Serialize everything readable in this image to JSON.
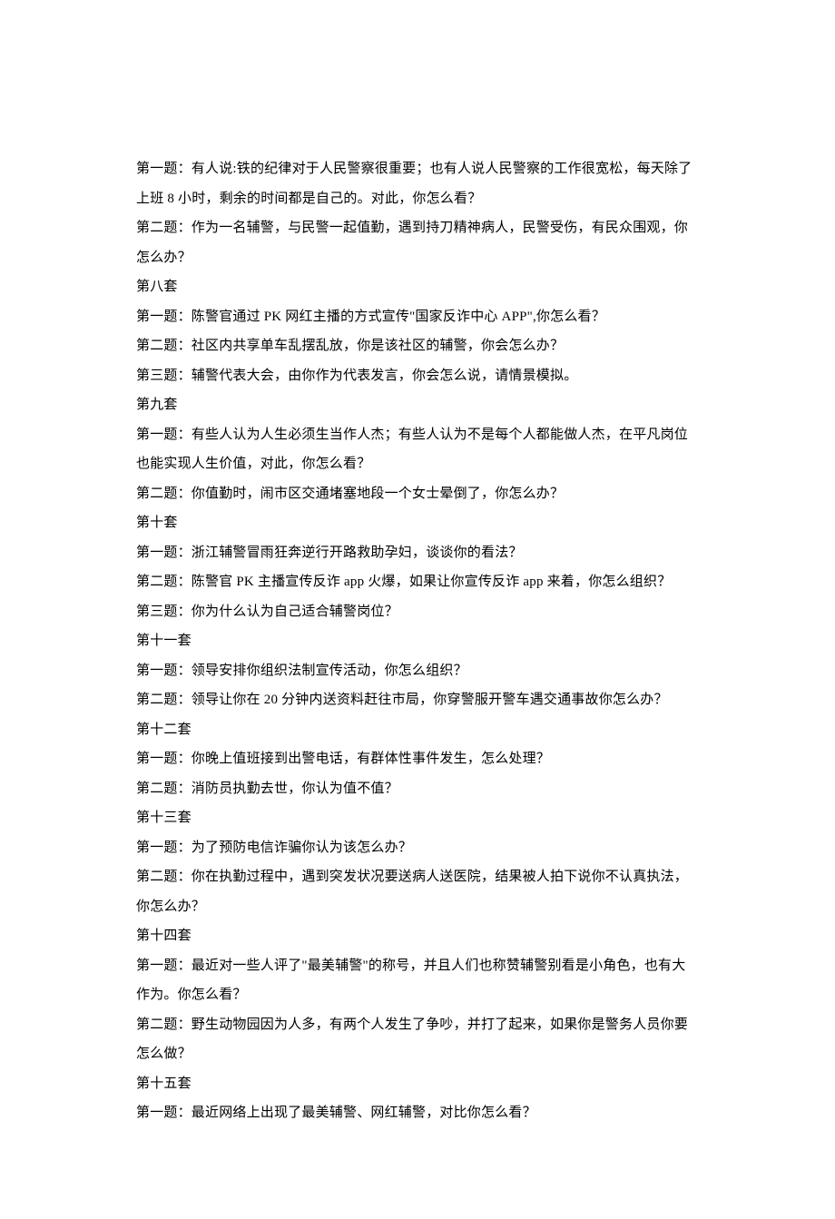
{
  "lines": [
    "第一题：有人说:铁的纪律对于人民警察很重要；也有人说人民警察的工作很宽松，每天除了上班 8 小时，剩余的时间都是自己的。对此，你怎么看？",
    "第二题：作为一名辅警，与民警一起值勤，遇到持刀精神病人，民警受伤，有民众围观，你怎么办？",
    "第八套",
    "第一题：陈警官通过 PK 网红主播的方式宣传\"国家反诈中心 APP\",你怎么看？",
    "第二题：社区内共享单车乱摆乱放，你是该社区的辅警，你会怎么办？",
    "第三题：辅警代表大会，由你作为代表发言，你会怎么说，请情景模拟。",
    "第九套",
    "第一题：有些人认为人生必须生当作人杰；有些人认为不是每个人都能做人杰，在平凡岗位也能实现人生价值，对此，你怎么看？",
    "第二题：你值勤时，闹市区交通堵塞地段一个女士晕倒了，你怎么办？",
    "第十套",
    "第一题：浙江辅警冒雨狂奔逆行开路救助孕妇，谈谈你的看法？",
    "第二题：陈警官 PK 主播宣传反诈 app 火爆，如果让你宣传反诈 app 来着，你怎么组织？",
    "第三题：你为什么认为自己适合辅警岗位？",
    "第十一套",
    "第一题：领导安排你组织法制宣传活动，你怎么组织？",
    "第二题：领导让你在 20 分钟内送资料赶往市局，你穿警服开警车遇交通事故你怎么办？",
    "第十二套",
    "第一题：你晚上值班接到出警电话，有群体性事件发生，怎么处理？",
    "第二题：消防员执勤去世，你认为值不值？",
    "第十三套",
    "第一题：为了预防电信诈骗你认为该怎么办？",
    "第二题：你在执勤过程中，遇到突发状况要送病人送医院，结果被人拍下说你不认真执法，你怎么办？",
    "第十四套",
    "第一题：最近对一些人评了\"最美辅警\"的称号，并且人们也称赞辅警别看是小角色，也有大作为。你怎么看？",
    "第二题：野生动物园因为人多，有两个人发生了争吵，并打了起来，如果你是警务人员你要怎么做？",
    "第十五套",
    "第一题：最近网络上出现了最美辅警、网红辅警，对比你怎么看？"
  ]
}
